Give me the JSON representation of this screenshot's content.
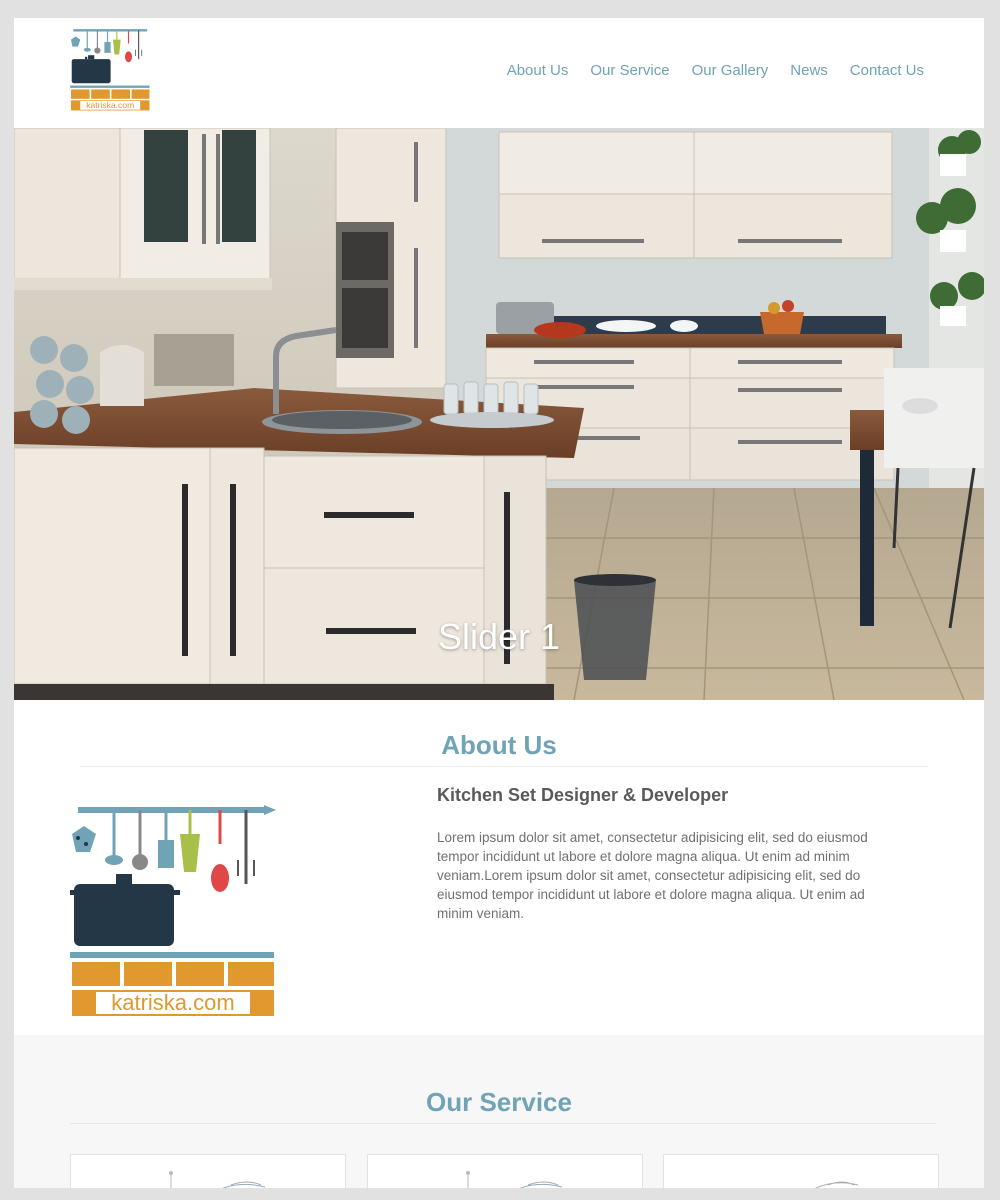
{
  "header": {
    "logo_text": "katriska.com",
    "nav": [
      "About Us",
      "Our Service",
      "Our Gallery",
      "News",
      "Contact Us"
    ]
  },
  "hero": {
    "caption": "Slider 1"
  },
  "about": {
    "title": "About Us",
    "subtitle": "Kitchen Set Designer & Developer",
    "body": "Lorem ipsum dolor sit amet, consectetur adipisicing elit, sed do eiusmod tempor incididunt ut labore et dolore magna aliqua. Ut enim ad minim veniam.Lorem ipsum dolor sit amet, consectetur adipisicing elit, sed do eiusmod tempor incididunt ut labore et dolore magna aliqua. Ut enim ad minim veniam.",
    "logo_text": "katriska.com"
  },
  "service": {
    "title": "Our Service"
  },
  "colors": {
    "accent": "#6fa3b5",
    "brick": "#e1982f",
    "pot": "#243746"
  }
}
